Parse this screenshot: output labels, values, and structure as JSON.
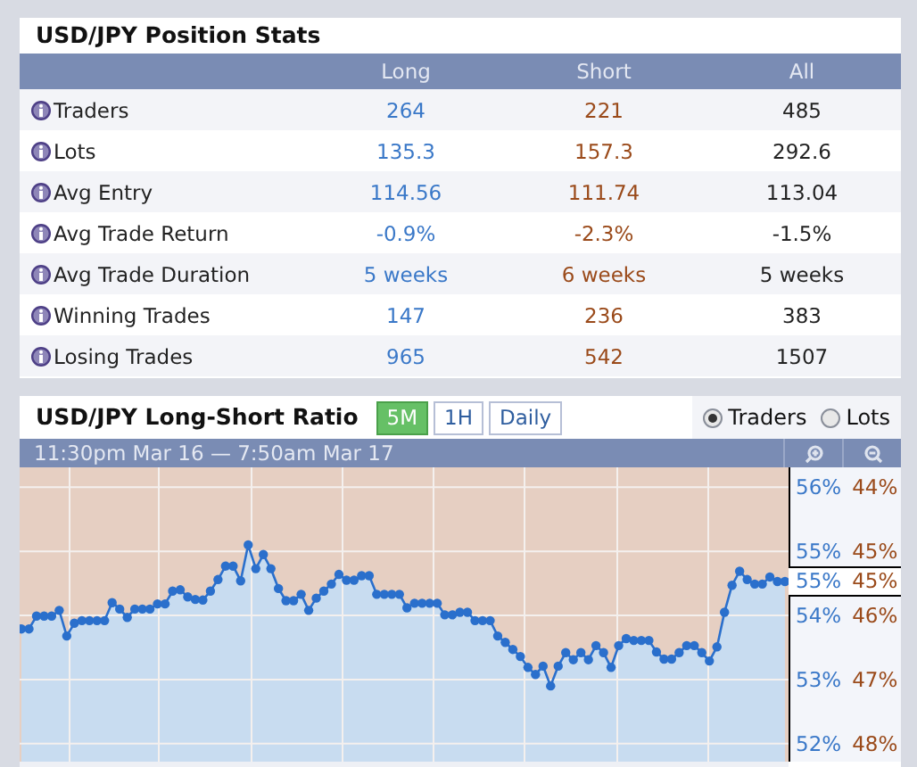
{
  "stats": {
    "title": "USD/JPY Position Stats",
    "columns": [
      "Long",
      "Short",
      "All"
    ],
    "rows": [
      {
        "label": "Traders",
        "long": "264",
        "short": "221",
        "all": "485"
      },
      {
        "label": "Lots",
        "long": "135.3",
        "short": "157.3",
        "all": "292.6"
      },
      {
        "label": "Avg Entry",
        "long": "114.56",
        "short": "111.74",
        "all": "113.04"
      },
      {
        "label": "Avg Trade Return",
        "long": "-0.9%",
        "short": "-2.3%",
        "all": "-1.5%"
      },
      {
        "label": "Avg Trade Duration",
        "long": "5 weeks",
        "short": "6 weeks",
        "all": "5 weeks"
      },
      {
        "label": "Winning Trades",
        "long": "147",
        "short": "236",
        "all": "383"
      },
      {
        "label": "Losing Trades",
        "long": "965",
        "short": "542",
        "all": "1507"
      }
    ]
  },
  "ratio": {
    "title": "USD/JPY Long-Short Ratio",
    "intervals": [
      {
        "label": "5M",
        "selected": true
      },
      {
        "label": "1H",
        "selected": false
      },
      {
        "label": "Daily",
        "selected": false
      }
    ],
    "modes": [
      {
        "label": "Traders",
        "selected": true
      },
      {
        "label": "Lots",
        "selected": false
      }
    ],
    "range": "11:30pm Mar 16 — 7:50am Mar 17",
    "short_axis": [
      "44%",
      "45%",
      "46%",
      "47%",
      "48%"
    ],
    "current": {
      "long": "55%",
      "short": "45%"
    },
    "chart_data": {
      "type": "area",
      "grid": true,
      "ylim": [
        51.72,
        56.31
      ],
      "yticks": [
        {
          "value": 56,
          "label": "56%"
        },
        {
          "value": 55,
          "label": "55%"
        },
        {
          "value": 54,
          "label": "54%"
        },
        {
          "value": 53,
          "label": "53%"
        },
        {
          "value": 52,
          "label": "52%"
        }
      ],
      "series": [
        {
          "marker": "o",
          "color": "#2a6fcc",
          "values": [
            53.79,
            53.79,
            53.99,
            53.99,
            53.99,
            54.08,
            53.68,
            53.88,
            53.92,
            53.92,
            53.92,
            53.92,
            54.2,
            54.1,
            53.97,
            54.1,
            54.1,
            54.1,
            54.18,
            54.18,
            54.38,
            54.4,
            54.29,
            54.25,
            54.24,
            54.38,
            54.56,
            54.77,
            54.77,
            54.54,
            55.1,
            54.73,
            54.95,
            54.73,
            54.42,
            54.23,
            54.23,
            54.33,
            54.08,
            54.27,
            54.38,
            54.49,
            54.64,
            54.55,
            54.55,
            54.62,
            54.62,
            54.33,
            54.33,
            54.33,
            54.33,
            54.12,
            54.19,
            54.19,
            54.19,
            54.19,
            54.01,
            54.01,
            54.05,
            54.05,
            53.92,
            53.92,
            53.92,
            53.68,
            53.58,
            53.47,
            53.36,
            53.19,
            53.08,
            53.21,
            52.9,
            53.21,
            53.42,
            53.31,
            53.42,
            53.31,
            53.53,
            53.42,
            53.19,
            53.53,
            53.64,
            53.61,
            53.61,
            53.61,
            53.43,
            53.32,
            53.32,
            53.42,
            53.53,
            53.53,
            53.42,
            53.29,
            53.51,
            54.05,
            54.47,
            54.69,
            54.56,
            54.49,
            54.49,
            54.6,
            54.53,
            54.53
          ]
        }
      ]
    }
  }
}
